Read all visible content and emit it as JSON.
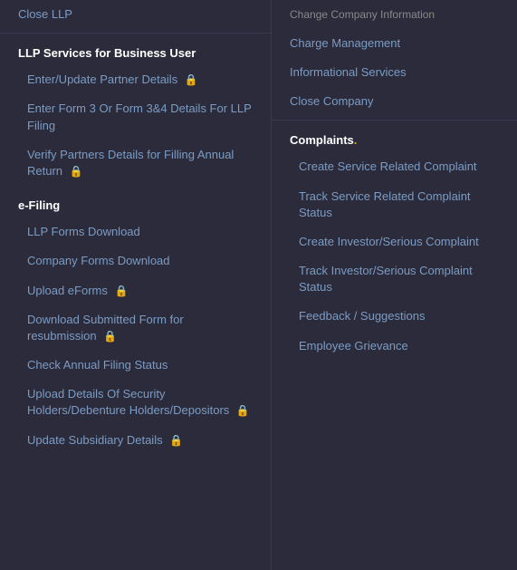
{
  "leftPanel": {
    "topItem": {
      "label": "Close LLP"
    },
    "llpSection": {
      "header": "LLP Services for Business User",
      "items": [
        {
          "label": "Enter/Update Partner Details",
          "locked": true
        },
        {
          "label": "Enter Form 3 Or Form 3&4 Details For LLP Filing",
          "locked": false
        },
        {
          "label": "Verify Partners Details for Filling Annual Return",
          "locked": true
        }
      ]
    },
    "eFilingSection": {
      "header": "e-Filing",
      "items": [
        {
          "label": "LLP Forms Download",
          "locked": false
        },
        {
          "label": "Company Forms Download",
          "locked": false
        },
        {
          "label": "Upload eForms",
          "locked": true
        },
        {
          "label": "Download Submitted Form for resubmission",
          "locked": true
        },
        {
          "label": "Check Annual Filing Status",
          "locked": false
        },
        {
          "label": "Upload Details Of Security Holders/Debenture Holders/Depositors",
          "locked": true
        },
        {
          "label": "Update Subsidiary Details",
          "locked": true
        }
      ]
    }
  },
  "rightPanel": {
    "topItems": [
      {
        "label": "Charge Management"
      },
      {
        "label": "Informational Services"
      },
      {
        "label": "Close Company"
      }
    ],
    "complaintsSection": {
      "header": "Complaints",
      "items": [
        {
          "label": "Create Service Related Complaint"
        },
        {
          "label": "Track Service Related Complaint Status"
        },
        {
          "label": "Create Investor/Serious Complaint"
        },
        {
          "label": "Track Investor/Serious Complaint Status"
        },
        {
          "label": "Feedback / Suggestions"
        },
        {
          "label": "Employee Grievance"
        }
      ]
    }
  },
  "icons": {
    "lock": "🔒"
  }
}
